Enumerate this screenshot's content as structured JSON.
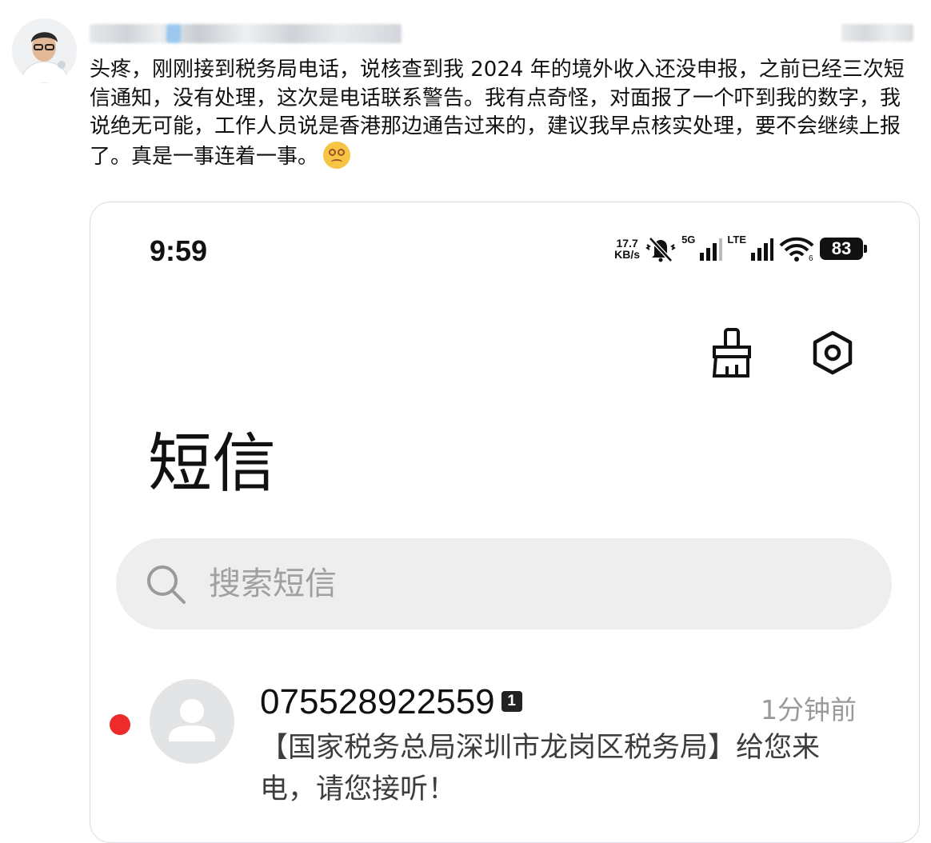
{
  "post": {
    "text": "头疼，刚刚接到税务局电话，说核查到我 2024 年的境外收入还没申报，之前已经三次短信通知，没有处理，这次是电话联系警告。我有点奇怪，对面报了一个吓到我的数字，我说绝无可能，工作人员说是香港那边通告过来的，建议我早点核实处理，要不会继续上报了。真是一事连着一事。",
    "emoji": "dizzy-face-emoji"
  },
  "phone": {
    "status_bar": {
      "time": "9:59",
      "speed_value": "17.7",
      "speed_unit": "KB/s",
      "sim1_label": "5G",
      "sim2_label": "LTE",
      "battery": "83"
    },
    "title": "短信",
    "search": {
      "placeholder": "搜索短信"
    },
    "messages": [
      {
        "sender": "075528922559",
        "count": "1",
        "time": "1分钟前",
        "preview": "【国家税务总局深圳市龙岗区税务局】给您来电，请您接听！",
        "unread": true
      }
    ]
  },
  "colors": {
    "unread_dot": "#ef2a2a",
    "search_bg": "#eeeeee",
    "emoji": "#f7c544"
  }
}
